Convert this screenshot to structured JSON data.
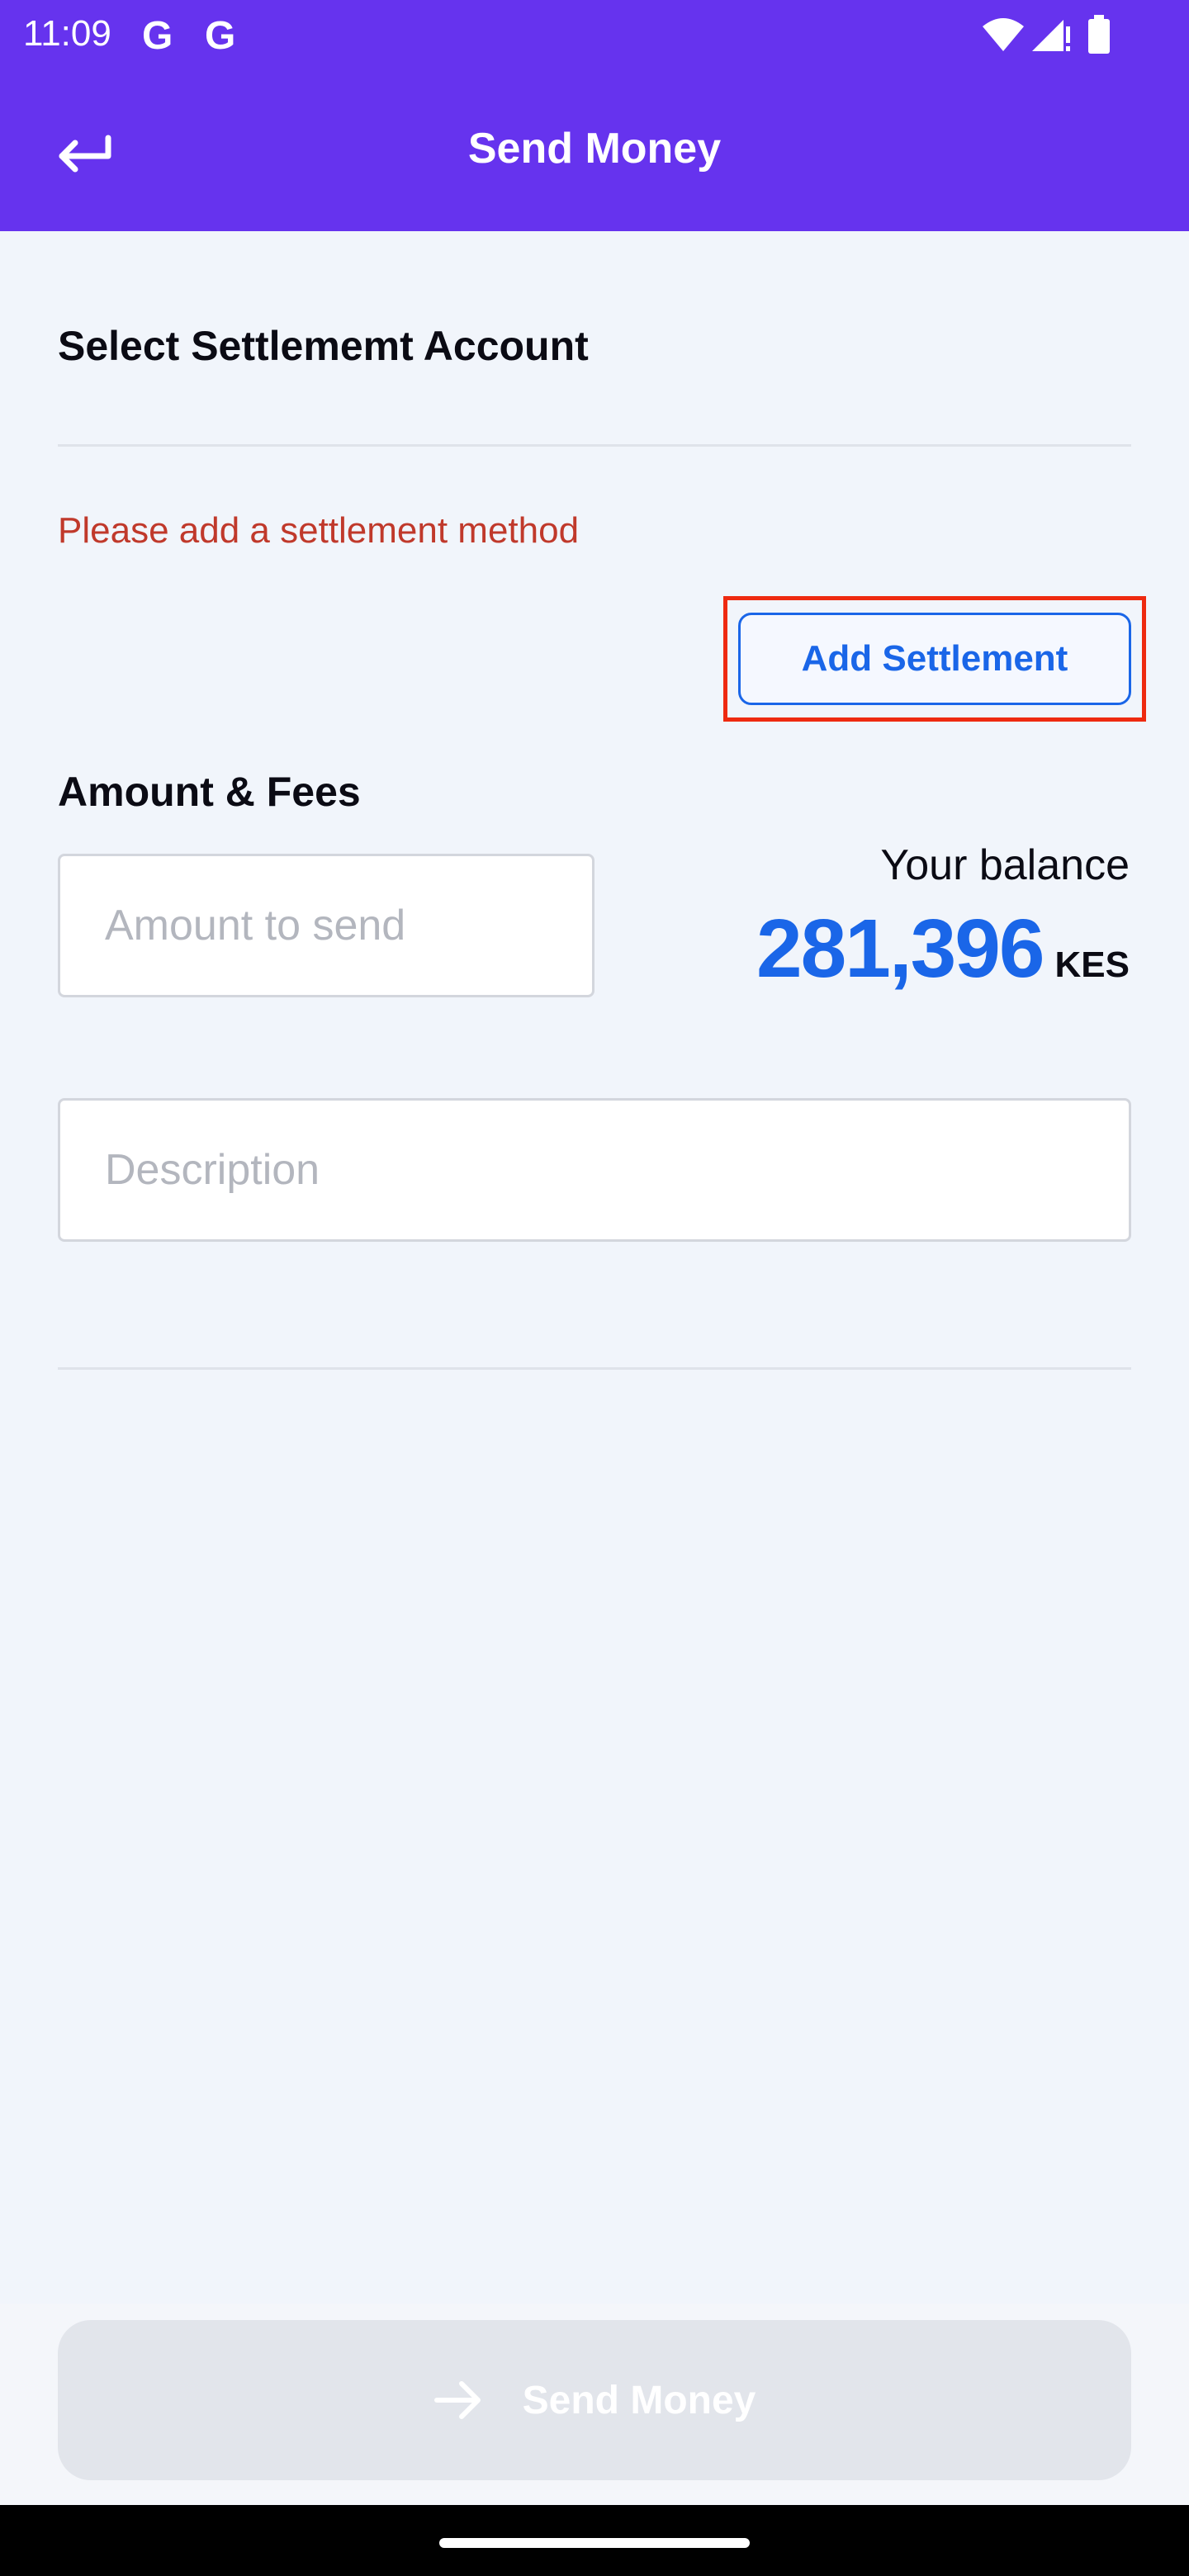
{
  "status_bar": {
    "time": "11:09",
    "notification_icons": [
      "G",
      "G"
    ]
  },
  "header": {
    "title": "Send Money",
    "back_icon": "back-arrow-icon",
    "background": "#6633ee"
  },
  "settlement": {
    "title": "Select Settlememt Account",
    "error_text": "Please add a settlement method",
    "add_button_label": "Add Settlement"
  },
  "amount_fees": {
    "title": "Amount & Fees",
    "amount_placeholder": "Amount to send",
    "balance_label": "Your balance",
    "balance_value": "281,396",
    "currency": "KES"
  },
  "description": {
    "placeholder": "Description"
  },
  "footer": {
    "send_label": "Send Money",
    "send_icon": "arrow-right-icon"
  },
  "colors": {
    "accent": "#1a66e8",
    "error": "#c0392b",
    "highlight": "#ee2a10"
  }
}
